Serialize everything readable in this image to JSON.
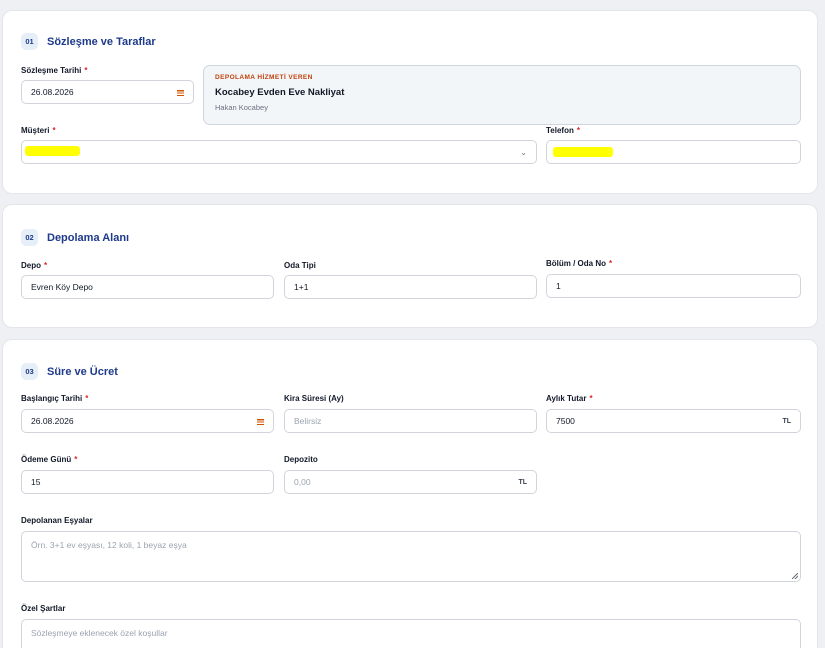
{
  "section1": {
    "number": "01",
    "title": "Sözleşme ve Taraflar",
    "contract_date_label": "Sözleşme Tarihi",
    "contract_date": "26.08.2026",
    "provider_tag": "DEPOLAMA HİZMETİ VEREN",
    "provider_name": "Kocabey Evden Eve Nakliyat",
    "provider_person": "Hakan Kocabey",
    "customer_label": "Müşteri",
    "phone_label": "Telefon"
  },
  "section2": {
    "number": "02",
    "title": "Depolama Alanı",
    "depot_label": "Depo",
    "depot_value": "Evren Köy Depo",
    "room_type_label": "Oda Tipi",
    "room_type_value": "1+1",
    "section_room_label": "Bölüm / Oda No",
    "section_room_value": "1"
  },
  "section3": {
    "number": "03",
    "title": "Süre ve Ücret",
    "start_date_label": "Başlangıç Tarihi",
    "start_date": "26.08.2026",
    "rent_period_label": "Kira Süresi (Ay)",
    "rent_period_placeholder": "Belirsiz",
    "monthly_fee_label": "Aylık Tutar",
    "monthly_fee_value": "7500",
    "currency": "TL",
    "payment_day_label": "Ödeme Günü",
    "payment_day_value": "15",
    "deposit_label": "Depozito",
    "deposit_placeholder": "0,00",
    "items_label": "Depolanan Eşyalar",
    "items_placeholder": "Örn. 3+1 ev eşyası, 12 koli, 1 beyaz eşya",
    "terms_label": "Özel Şartlar",
    "terms_placeholder": "Sözleşmeye eklenecek özel koşullar"
  },
  "required_mark": "*",
  "colors": {
    "accent": "#1e3a8a",
    "required": "#dc2626",
    "provider_tag": "#c2410c",
    "redaction": "#ffff00"
  }
}
